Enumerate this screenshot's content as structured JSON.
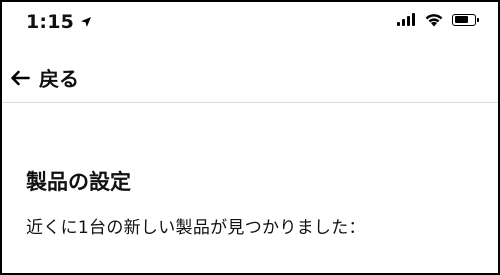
{
  "status_bar": {
    "time": "1:15",
    "location_icon": "location-arrow-icon",
    "signal_icon": "cellular-signal-icon",
    "wifi_icon": "wifi-icon",
    "battery_icon": "battery-icon",
    "battery_level": 0.75
  },
  "nav": {
    "back_icon": "arrow-left-icon",
    "back_label": "戻る"
  },
  "main": {
    "title": "製品の設定",
    "description": "近くに1台の新しい製品が見つかりました："
  }
}
